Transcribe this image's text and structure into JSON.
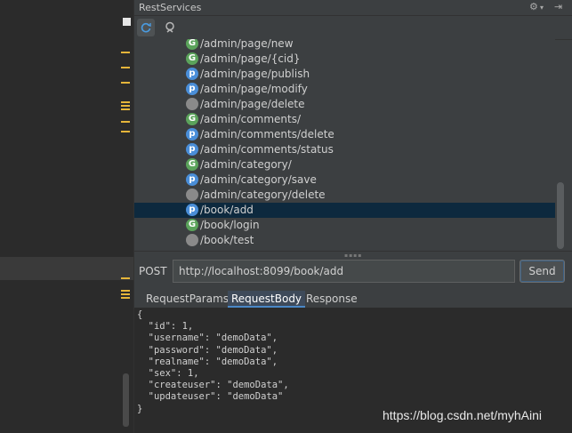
{
  "panel": {
    "title": "RestServices",
    "gear_glyph": "⚙",
    "gear_arrow": "▾",
    "hide_glyph": "⇥"
  },
  "toolbar": {
    "refresh_icon": "refresh-icon",
    "search_icon": "search-icon"
  },
  "tree": {
    "items": [
      {
        "badge": "G",
        "kind": "G",
        "path": "/admin/page/new"
      },
      {
        "badge": "G",
        "kind": "G",
        "path": "/admin/page/{cid}"
      },
      {
        "badge": "p",
        "kind": "P",
        "path": "/admin/page/publish"
      },
      {
        "badge": "p",
        "kind": "P",
        "path": "/admin/page/modify"
      },
      {
        "badge": "",
        "kind": "N",
        "path": "/admin/page/delete"
      },
      {
        "badge": "G",
        "kind": "G",
        "path": "/admin/comments/"
      },
      {
        "badge": "p",
        "kind": "P",
        "path": "/admin/comments/delete"
      },
      {
        "badge": "p",
        "kind": "P",
        "path": "/admin/comments/status"
      },
      {
        "badge": "G",
        "kind": "G",
        "path": "/admin/category/"
      },
      {
        "badge": "p",
        "kind": "P",
        "path": "/admin/category/save"
      },
      {
        "badge": "",
        "kind": "N",
        "path": "/admin/category/delete"
      },
      {
        "badge": "p",
        "kind": "P",
        "path": "/book/add"
      },
      {
        "badge": "G",
        "kind": "G",
        "path": "/book/login"
      },
      {
        "badge": "",
        "kind": "N",
        "path": "/book/test"
      }
    ],
    "selected_index": 11
  },
  "request": {
    "method": "POST",
    "url": "http://localhost:8099/book/add",
    "send_label": "Send"
  },
  "tabs": [
    {
      "label": "RequestParams"
    },
    {
      "label": "RequestBody"
    },
    {
      "label": "Response"
    }
  ],
  "active_tab": 1,
  "body_text": "{\n  \"id\": 1,\n  \"username\": \"demoData\",\n  \"password\": \"demoData\",\n  \"realname\": \"demoData\",\n  \"sex\": 1,\n  \"createuser\": \"demoData\",\n  \"updateuser\": \"demoData\"\n}",
  "watermark": "https://blog.csdn.net/myhAini",
  "colors": {
    "get_badge": "#5ba35b",
    "post_badge": "#4a8ed8",
    "other_badge": "#8a8a8a",
    "selection": "#0d293e",
    "gutter_mark": "#e5b53a"
  }
}
